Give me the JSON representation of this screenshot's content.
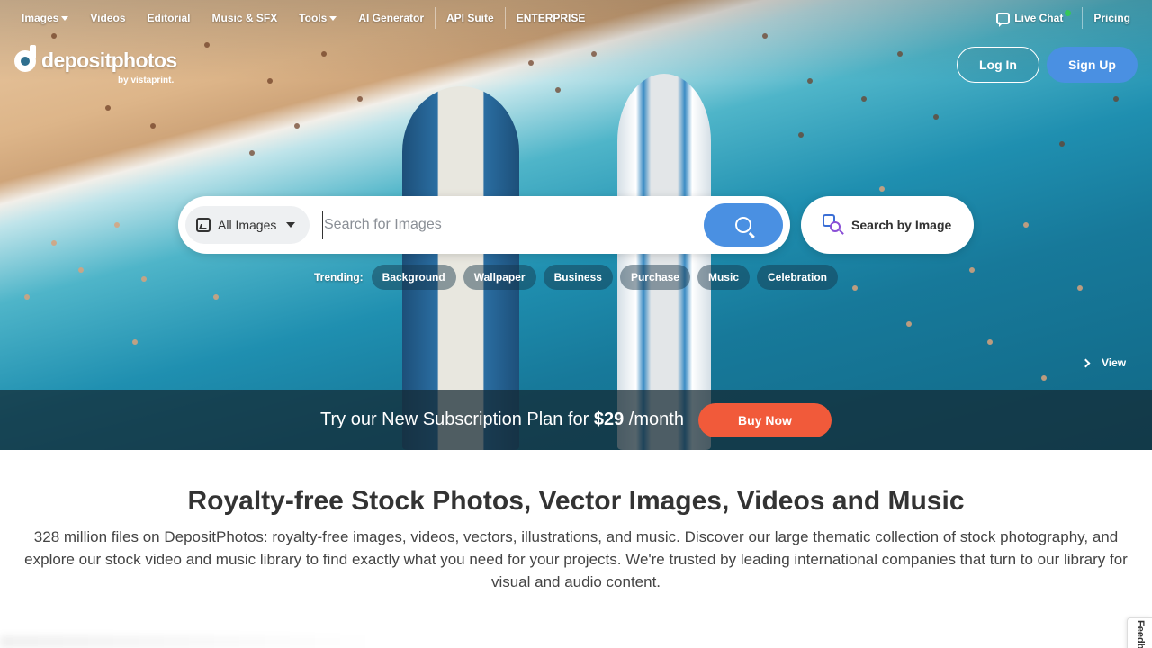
{
  "topnav": {
    "images": "Images",
    "videos": "Videos",
    "editorial": "Editorial",
    "music_sfx": "Music & SFX",
    "tools": "Tools",
    "ai_generator": "AI Generator",
    "api_suite": "API Suite",
    "enterprise": "ENTERPRISE",
    "live_chat": "Live Chat",
    "pricing": "Pricing"
  },
  "logo": {
    "text": "depositphotos",
    "sub": "by vistaprint."
  },
  "auth": {
    "login": "Log In",
    "signup": "Sign Up"
  },
  "search": {
    "category": "All Images",
    "placeholder": "Search for Images",
    "value": "",
    "by_image": "Search by Image"
  },
  "trending": {
    "label": "Trending:",
    "items": [
      "Background",
      "Wallpaper",
      "Business",
      "Purchase",
      "Music",
      "Celebration"
    ]
  },
  "view_link": "View",
  "promo": {
    "text_before": "Try our New Subscription Plan for",
    "price": "$29",
    "text_after": "/month",
    "button": "Buy Now"
  },
  "content": {
    "headline": "Royalty-free Stock Photos, Vector Images, Videos and Music",
    "description": "328 million files on DepositPhotos: royalty-free images, videos, vectors, illustrations, and music. Discover our large thematic collection of stock photography, and explore our stock video and music library to find exactly what you need for your projects. We're trusted by leading international companies that turn to our library for visual and audio content."
  },
  "feedback_tab": "Feedback",
  "colors": {
    "accent": "#4a90e2",
    "buy_now": "#f15a3a",
    "online": "#35c759"
  }
}
